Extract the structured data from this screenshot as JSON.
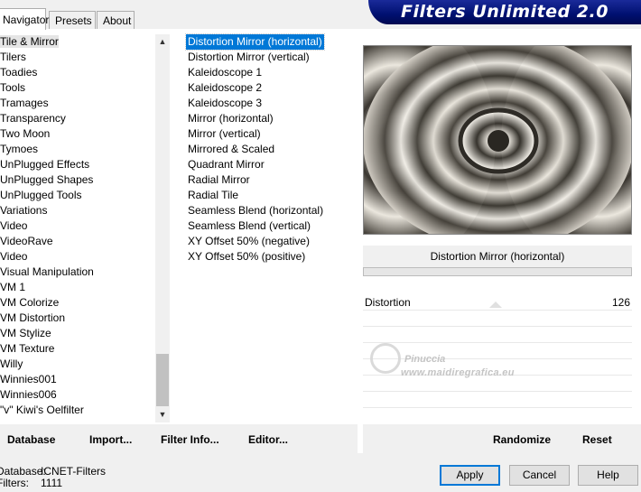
{
  "tabs": [
    {
      "label": "Navigator"
    },
    {
      "label": "Presets"
    },
    {
      "label": "About"
    }
  ],
  "banner": {
    "title": "Filters Unlimited 2.0"
  },
  "categories": [
    "Tile & Mirror",
    "Tilers",
    "Toadies",
    "Tools",
    "Tramages",
    "Transparency",
    "Two Moon",
    "Tymoes",
    "UnPlugged Effects",
    "UnPlugged Shapes",
    "UnPlugged Tools",
    "Variations",
    "Video",
    "VideoRave",
    "Video",
    "Visual Manipulation",
    "VM 1",
    "VM Colorize",
    "VM Distortion",
    "VM Stylize",
    "VM Texture",
    "Willy",
    "Winnies001",
    "Winnies006",
    "\"v\" Kiwi's Oelfilter"
  ],
  "selected_category_index": 0,
  "filters": [
    "Distortion Mirror (horizontal)",
    "Distortion Mirror (vertical)",
    "Kaleidoscope 1",
    "Kaleidoscope 2",
    "Kaleidoscope 3",
    "Mirror (horizontal)",
    "Mirror (vertical)",
    "Mirrored & Scaled",
    "Quadrant Mirror",
    "Radial Mirror",
    "Radial Tile",
    "Seamless Blend (horizontal)",
    "Seamless Blend (vertical)",
    "XY Offset 50% (negative)",
    "XY Offset 50% (positive)"
  ],
  "selected_filter_index": 0,
  "preview": {
    "filter_name": "Distortion Mirror (horizontal)"
  },
  "params": [
    {
      "label": "Distortion",
      "value": "126"
    }
  ],
  "watermark": {
    "name": "Pinuccia",
    "url": "www.maidiregrafica.eu"
  },
  "bottom_buttons": {
    "database": "Database",
    "import": "Import...",
    "filter_info": "Filter Info...",
    "editor": "Editor...",
    "randomize": "Randomize",
    "reset": "Reset"
  },
  "status": {
    "database_label": "Database:",
    "database_value": "ICNET-Filters",
    "filters_label": "Filters:",
    "filters_value": "1111"
  },
  "dialog": {
    "apply": "Apply",
    "cancel": "Cancel",
    "help": "Help"
  },
  "colors": {
    "selection": "#0078d7",
    "banner": "#001070"
  }
}
